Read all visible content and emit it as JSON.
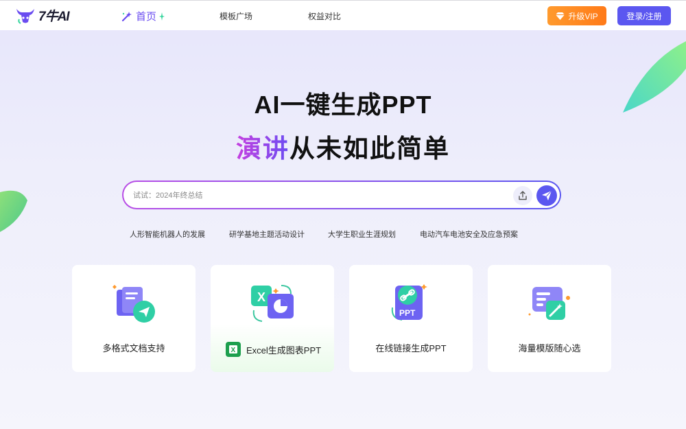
{
  "header": {
    "logo_text": "7牛AI",
    "nav": {
      "home": "首页",
      "templates": "模板广场",
      "compare": "权益对比"
    },
    "vip_label": "升级VIP",
    "login_label": "登录/注册"
  },
  "hero": {
    "title": "AI一键生成PPT",
    "subtitle_highlight": "演讲",
    "subtitle_rest": "从未如此简单"
  },
  "search": {
    "placeholder": "试试：2024年终总结",
    "value": ""
  },
  "suggestions": [
    "人形智能机器人的发展",
    "研学基地主题活动设计",
    "大学生职业生涯规划",
    "电动汽车电池安全及应急预案"
  ],
  "features": [
    {
      "label": "多格式文档支持",
      "icon": "documents-send-icon"
    },
    {
      "label": "Excel生成图表PPT",
      "icon": "excel-chart-icon",
      "badge": "X"
    },
    {
      "label": "在线链接生成PPT",
      "icon": "link-ppt-icon",
      "badge_text": "PPT"
    },
    {
      "label": "海量模版随心选",
      "icon": "template-magic-icon"
    }
  ],
  "colors": {
    "accent": "#5b57f0",
    "vip": "#ff8a22",
    "excel": "#1d9f4e"
  }
}
